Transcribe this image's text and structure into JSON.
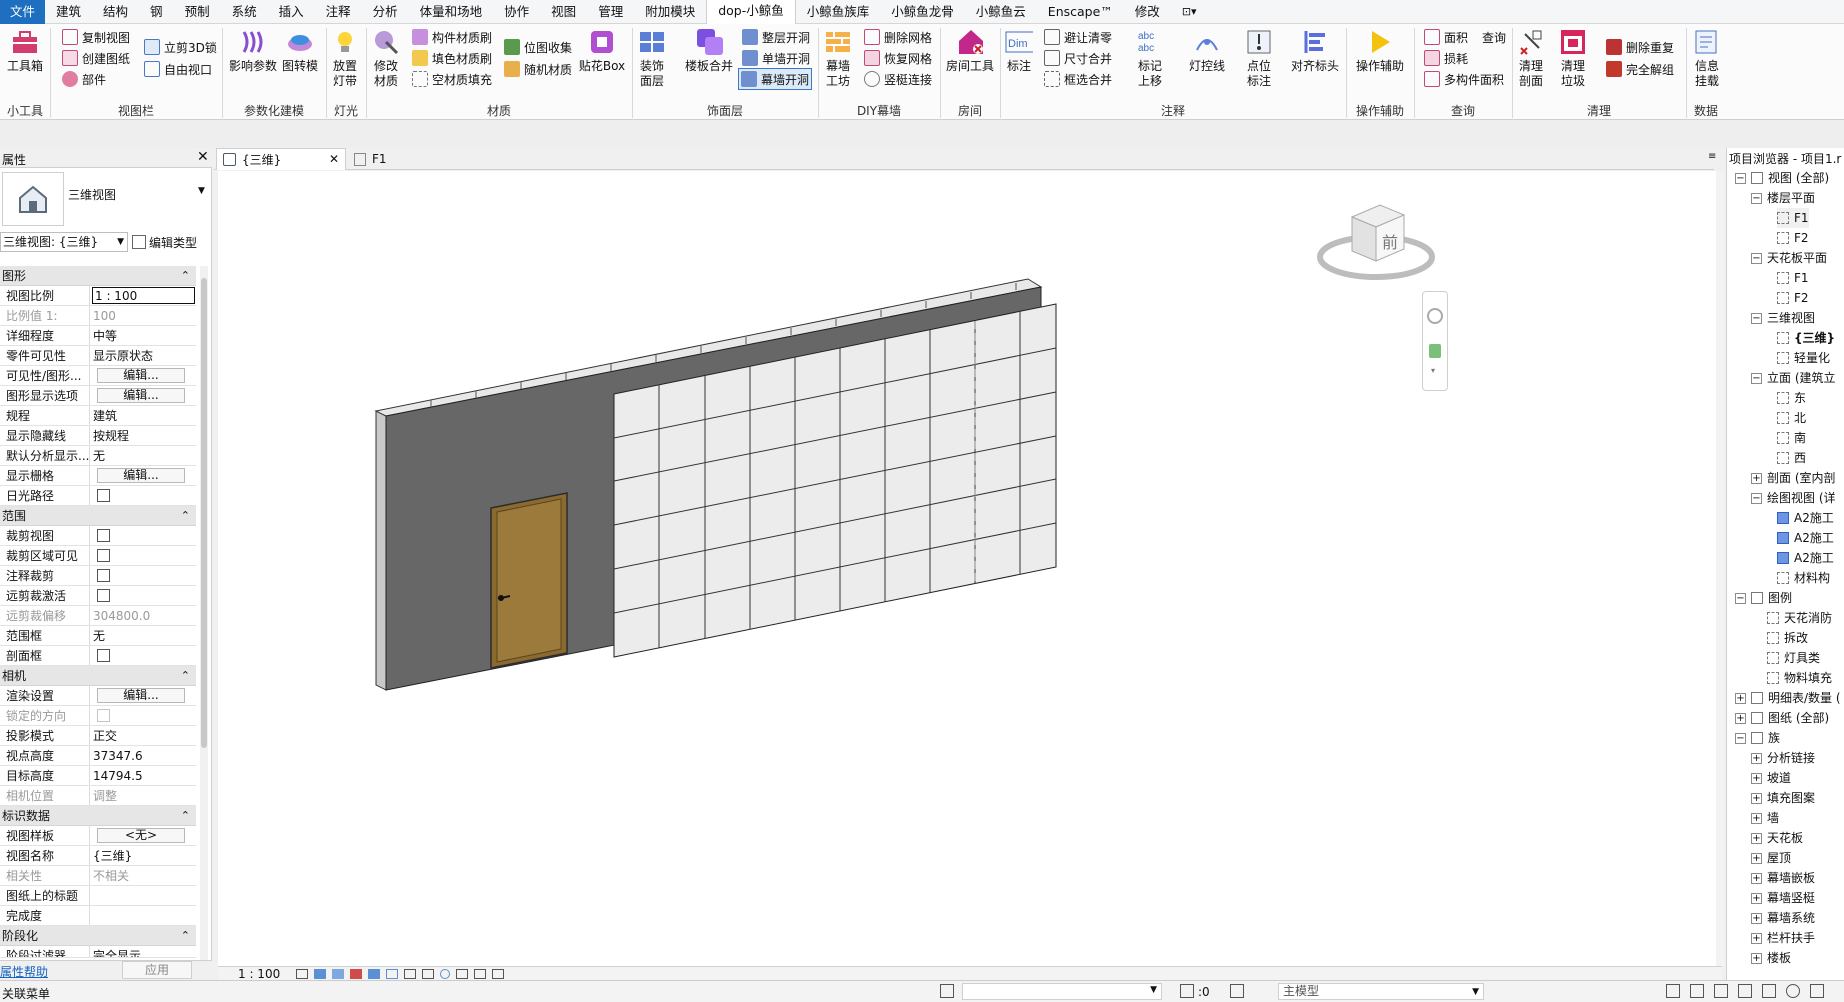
{
  "menubar": {
    "items": [
      "文件",
      "建筑",
      "结构",
      "钢",
      "预制",
      "系统",
      "插入",
      "注释",
      "分析",
      "体量和场地",
      "协作",
      "视图",
      "管理",
      "附加模块",
      "dop-小鲸鱼",
      "小鲸鱼族库",
      "小鲸鱼龙骨",
      "小鲸鱼云",
      "Enscape™",
      "修改"
    ],
    "active_index": 14,
    "extra": "⊡▾"
  },
  "ribbon": {
    "toolbox": "工具箱",
    "copy_view": "复制视图",
    "create_sheet": "创建图纸",
    "parts": "部件",
    "section_box_3d": "立剪3D锁",
    "free_viewport": "自由视口",
    "influence_params": "影响参数",
    "image_convert_line1": "图转模",
    "light_btn_line1": "放置",
    "light_btn_line2": "灯带",
    "modify_mat_line1": "修改",
    "modify_mat_line2": "材质",
    "component_brush": "构件材质刷",
    "fill_brush": "填色材质刷",
    "empty_fill": "空材质填充",
    "bitmap_collect": "位图收集",
    "random_mat": "随机材质",
    "paste_box": "贴花Box",
    "decor_layer_line1": "装饰",
    "decor_layer_line2": "面层",
    "floor_merge": "楼板合并",
    "wall_opening_full": "整层开洞",
    "single_wall_opening": "单墙开洞",
    "curtain_opening": "幕墙开洞",
    "curtain_workshop_line1": "幕墙",
    "curtain_workshop_line2": "工坊",
    "delete_grid": "删除网格",
    "restore_grid": "恢复网格",
    "mullion_connect": "竖梃连接",
    "room_tool": "房间工具",
    "dim_label": "标注",
    "avoid_clear": "避让清零",
    "size_merge": "尺寸合并",
    "frame_merge": "框选合并",
    "tag_up_line1": "标记",
    "tag_up_line2": "上移",
    "light_line": "灯控线",
    "point_tag_line1": "点位",
    "point_tag_line2": "标注",
    "align_tag": "对齐标头",
    "op_assist": "操作辅助",
    "area": "面积",
    "query": "查询",
    "loss": "损耗",
    "multi_area": "多构件面积",
    "clean_section_line1": "清理",
    "clean_section_line2": "剖面",
    "clean_trash_line1": "清理",
    "clean_trash_line2": "垃圾",
    "remove_dup": "删除重复",
    "full_ungroup": "完全解组",
    "info_mount_line1": "信息",
    "info_mount_line2": "挂载",
    "panels": [
      "小工具",
      "视图栏",
      "参数化建模",
      "灯光",
      "材质",
      "饰面层",
      "DIY幕墙",
      "房间",
      "注释",
      "操作辅助",
      "查询",
      "清理",
      "数据"
    ]
  },
  "properties": {
    "title": "属性",
    "type_name": "三维视图",
    "selector": "三维视图: {三维}",
    "edit_type": "编辑类型",
    "help": "属性帮助",
    "apply": "应用",
    "groups": {
      "graphics": "图形",
      "extents": "范围",
      "camera": "相机",
      "identity": "标识数据",
      "phasing": "阶段化"
    },
    "edit": "编辑...",
    "rows": {
      "view_scale": [
        "视图比例",
        "1 : 100"
      ],
      "scale_value": [
        "比例值 1:",
        "100"
      ],
      "detail_level": [
        "详细程度",
        "中等"
      ],
      "parts_visibility": [
        "零件可见性",
        "显示原状态"
      ],
      "vg_overrides": [
        "可见性/图形...",
        ""
      ],
      "graphic_display": [
        "图形显示选项",
        ""
      ],
      "discipline": [
        "规程",
        "建筑"
      ],
      "hidden_lines": [
        "显示隐藏线",
        "按规程"
      ],
      "default_analysis": [
        "默认分析显示...",
        "无"
      ],
      "show_grids": [
        "显示栅格",
        ""
      ],
      "sun_path": [
        "日光路径",
        ""
      ],
      "crop_view": [
        "裁剪视图",
        ""
      ],
      "crop_visible": [
        "裁剪区域可见",
        ""
      ],
      "annotation_crop": [
        "注释裁剪",
        ""
      ],
      "far_clip_active": [
        "远剪裁激活",
        ""
      ],
      "far_clip_offset": [
        "远剪裁偏移",
        "304800.0"
      ],
      "scope_box": [
        "范围框",
        "无"
      ],
      "section_box": [
        "剖面框",
        ""
      ],
      "render_settings": [
        "渲染设置",
        ""
      ],
      "locked_orient": [
        "锁定的方向",
        ""
      ],
      "projection": [
        "投影模式",
        "正交"
      ],
      "eye_elevation": [
        "视点高度",
        "37347.6"
      ],
      "target_elevation": [
        "目标高度",
        "14794.5"
      ],
      "camera_position": [
        "相机位置",
        "调整"
      ],
      "view_template": [
        "视图样板",
        "<无>"
      ],
      "view_name": [
        "视图名称",
        "{三维}"
      ],
      "dependency": [
        "相关性",
        "不相关"
      ],
      "title_on_sheet": [
        "图纸上的标题",
        ""
      ],
      "completion": [
        "完成度",
        ""
      ],
      "phase_filter": [
        "阶段过滤器",
        "完全显示"
      ]
    }
  },
  "tabs": {
    "view_3d": "{三维}",
    "f1": "F1"
  },
  "viewcube": {
    "face": "前"
  },
  "browser": {
    "title": "项目浏览器 - 项目1.r",
    "items": [
      "视图 (全部)",
      "楼层平面",
      "F1",
      "F2",
      "天花板平面",
      "F1",
      "F2",
      "三维视图",
      "{三维}",
      "轻量化",
      "立面 (建筑立",
      "东",
      "北",
      "南",
      "西",
      "剖面 (室内剖",
      "绘图视图 (详",
      "A2施工",
      "A2施工",
      "A2施工",
      "材料构",
      "图例",
      "天花消防",
      "拆改",
      "灯具类",
      "物料填充",
      "明细表/数量 (",
      "图纸 (全部)",
      "族",
      "分析链接",
      "坡道",
      "填充图案",
      "墙",
      "天花板",
      "屋顶",
      "幕墙嵌板",
      "幕墙竖梃",
      "幕墙系统",
      "栏杆扶手",
      "楼板"
    ]
  },
  "viewctl": {
    "scale": "1 : 100"
  },
  "statusbar": {
    "left": "关联菜单",
    "zero": ":0",
    "model": "主模型"
  }
}
